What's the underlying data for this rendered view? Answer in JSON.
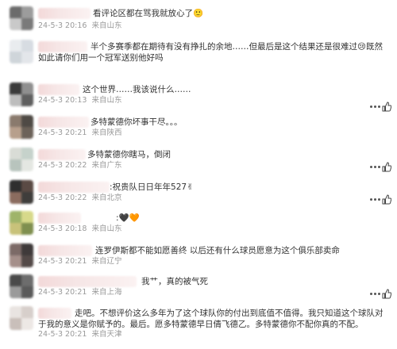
{
  "comments": [
    {
      "text": "看评论区都在骂我就放心了🙂",
      "date": "24-5-3 20:16",
      "location": "来自山东"
    },
    {
      "text": "半个多赛季都在期待有没有挣扎的余地……但最后是这个结果还是很难过😢既然如此请你们用一个冠军送别他好吗",
      "date": "24-5-3 20:13",
      "location": "来自山东"
    },
    {
      "text": "这个世界……我该说什么……",
      "date": "24-5-3 20:13",
      "location": "来自山东"
    },
    {
      "text": "多特蒙德你坏事干尽。。。",
      "date": "24-5-3 20:21",
      "location": "来自陕西"
    },
    {
      "text": "多特蒙德你瞎马，倒闭",
      "date": "24-5-3 20:22",
      "location": "来自广东"
    },
    {
      "text": ":祝贵队日日年年527✌",
      "date": "24-5-3 20:22",
      "location": "来自北京"
    },
    {
      "text": ":🖤🧡",
      "date": "24-5-3 20:18",
      "location": "来自山东"
    },
    {
      "text": "连罗伊斯都不能如愿善终 以后还有什么球员愿意为这个俱乐部卖命",
      "date": "24-5-3 20:21",
      "location": "来自辽宁"
    },
    {
      "text": "我艹，真的被气死",
      "date": "24-5-3 20:21",
      "location": "来自上海"
    },
    {
      "text": "走吧。不想评价这么多年为了这个球队你的付出到底值不值得。我只知道这个球队对于我的意义是你赋予的。最后。愿多特蒙德早日倩飞德乙。多特蒙德你不配你真的不配。",
      "date": "24-5-3 20:21",
      "location": "来自天津"
    }
  ]
}
